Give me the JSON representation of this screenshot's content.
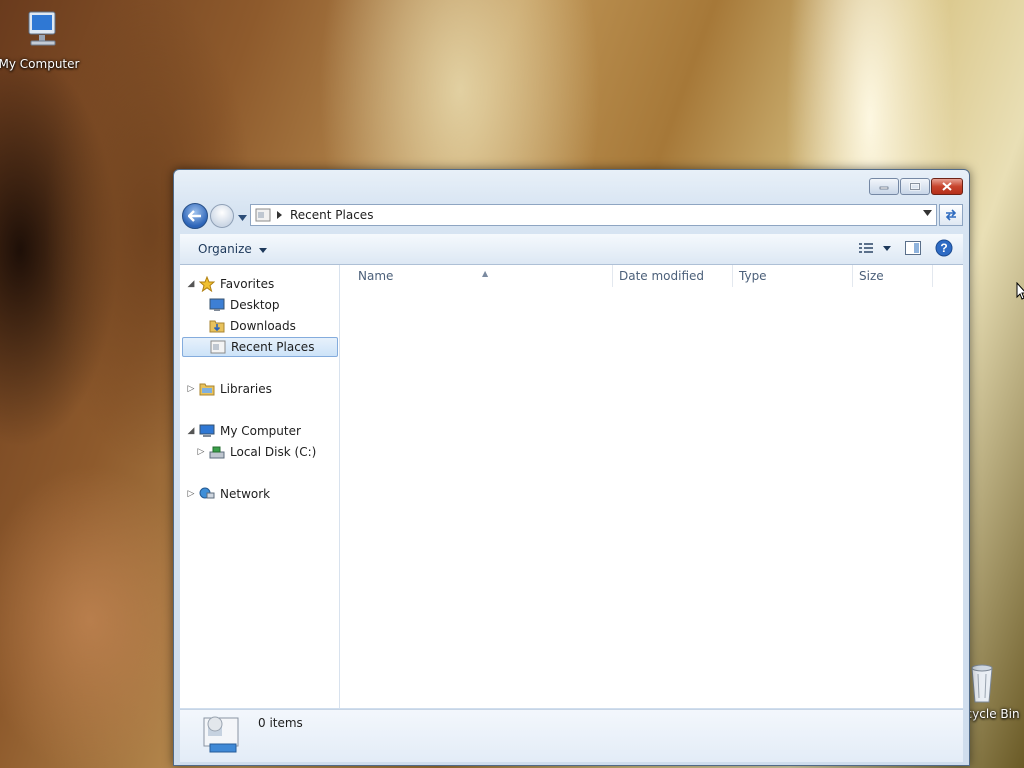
{
  "desktop": {
    "my_computer_label": "My Computer",
    "recycle_bin_label": "Recycle Bin"
  },
  "window": {
    "address_path": "Recent Places",
    "toolbar": {
      "organize_label": "Organize"
    },
    "nav": {
      "favorites": "Favorites",
      "desktop": "Desktop",
      "downloads": "Downloads",
      "recent_places": "Recent Places",
      "libraries": "Libraries",
      "my_computer": "My Computer",
      "local_disk": "Local Disk (C:)",
      "network": "Network"
    },
    "columns": [
      "Name",
      "Date modified",
      "Type",
      "Size"
    ],
    "status": {
      "item_count": "0 items"
    },
    "colors": {
      "accent": "#2c64b8",
      "close": "#c7442d"
    }
  },
  "icons": [
    "computer-icon",
    "recycle-bin-icon",
    "back-icon",
    "forward-icon",
    "refresh-icon",
    "star-icon",
    "folder-icon",
    "network-icon",
    "help-icon"
  ]
}
